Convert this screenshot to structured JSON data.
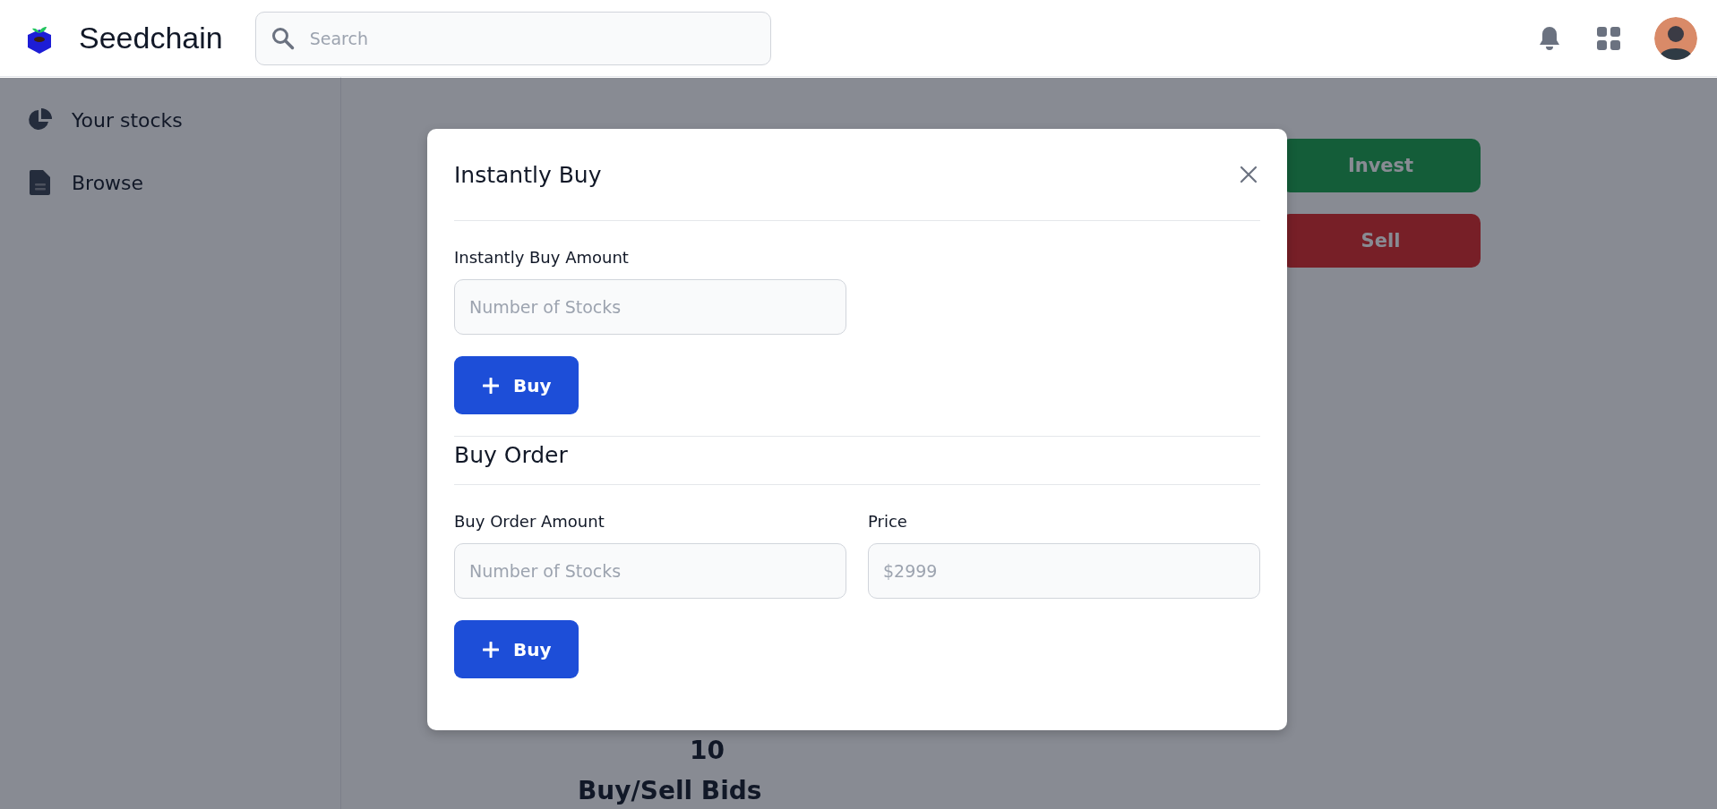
{
  "header": {
    "brand": "Seedchain",
    "search": {
      "placeholder": "Search"
    }
  },
  "sidebar": {
    "items": [
      {
        "label": "Your stocks",
        "kind": "pie"
      },
      {
        "label": "Browse",
        "kind": "document"
      }
    ]
  },
  "page": {
    "actions": [
      {
        "label": "Invest",
        "kind": "invest"
      },
      {
        "label": "Sell",
        "kind": "sell"
      }
    ],
    "count": "10",
    "section_title": "Buy/Sell Bids"
  },
  "modal": {
    "title": "Instantly Buy",
    "sections": [
      {
        "fields": [
          {
            "label": "Instantly Buy Amount",
            "placeholder": "Number of Stocks"
          }
        ],
        "button": "Buy"
      },
      {
        "title": "Buy Order",
        "fields": [
          {
            "label": "Buy Order Amount",
            "placeholder": "Number of Stocks"
          },
          {
            "label": "Price",
            "placeholder": "$2999"
          }
        ],
        "button": "Buy"
      }
    ]
  }
}
